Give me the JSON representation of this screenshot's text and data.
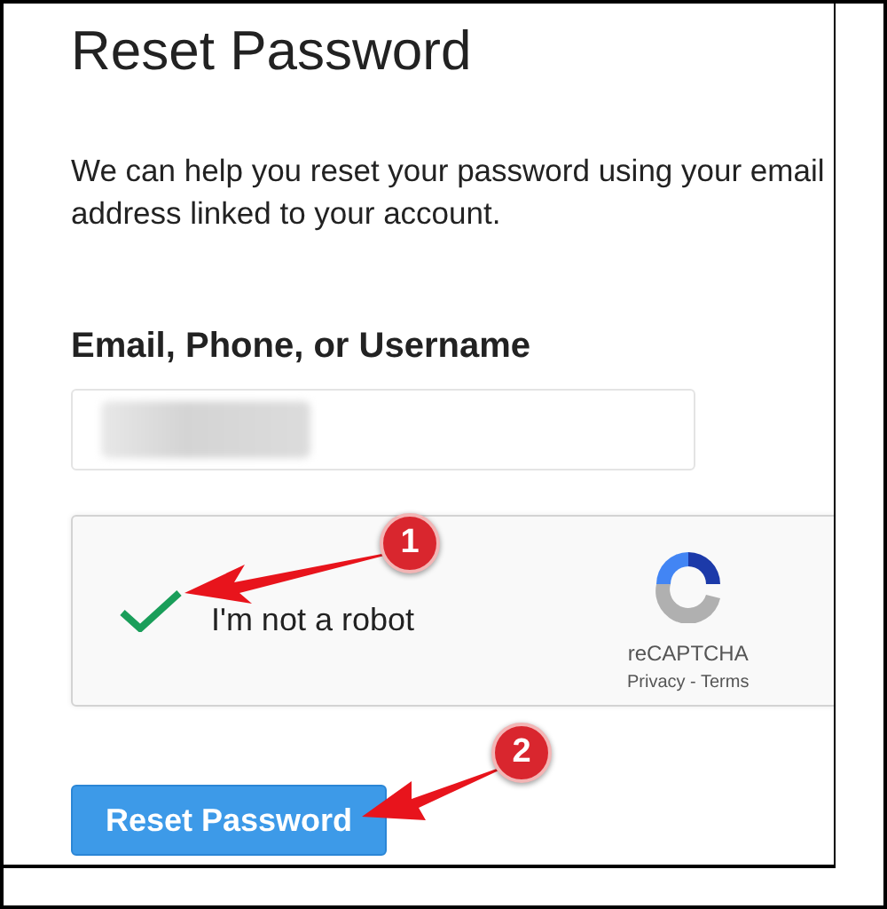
{
  "title": "Reset Password",
  "description": "We can help you reset your password using your email address linked to your account.",
  "field": {
    "label": "Email, Phone, or Username",
    "value_redacted": true
  },
  "captcha": {
    "checked": true,
    "label": "I'm not a robot",
    "brand": "reCAPTCHA",
    "links": "Privacy - Terms"
  },
  "button": "Reset Password",
  "annotations": [
    {
      "number": "1",
      "kind": "captcha"
    },
    {
      "number": "2",
      "kind": "button"
    }
  ]
}
